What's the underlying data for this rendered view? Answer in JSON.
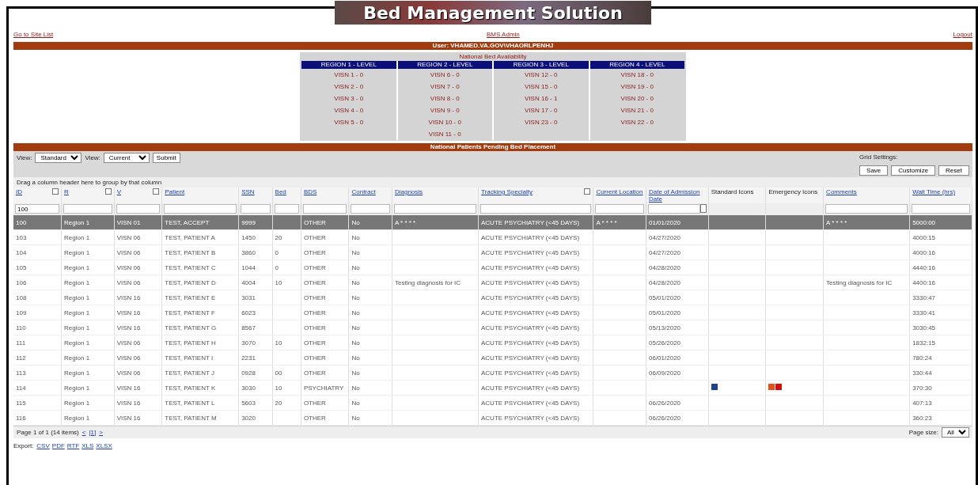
{
  "banner": {
    "title": "Bed Management Solution"
  },
  "top_links": [
    "Go to Site List",
    "BMS Admin",
    "Logout"
  ],
  "user_bar": "User: VHAMED.VA.GOV\\VHAORLPENHJ",
  "availability": {
    "title": "National Bed Availability",
    "regions": [
      {
        "label": "REGION 1 - LEVEL",
        "items": [
          "VISN 1 - 0",
          "VISN 2 - 0",
          "VISN 3 - 0",
          "VISN 4 - 0",
          "VISN 5 - 0"
        ]
      },
      {
        "label": "REGION 2 - LEVEL",
        "items": [
          "VISN 6 - 0",
          "VISN 7 - 0",
          "VISN 8 - 0",
          "VISN 9 - 0",
          "VISN 10 - 0",
          "VISN 11 - 0"
        ]
      },
      {
        "label": "REGION 3 - LEVEL",
        "items": [
          "VISN 12 - 0",
          "VISN 15 - 0",
          "VISN 16 - 1",
          "VISN 17 - 0",
          "VISN 23 - 0"
        ]
      },
      {
        "label": "REGION 4 - LEVEL",
        "items": [
          "VISN 18 - 0",
          "VISN 19 - 0",
          "VISN 20 - 0",
          "VISN 21 - 0",
          "VISN 22 - 0"
        ]
      }
    ]
  },
  "section_title": "National Patients Pending Bed Placement",
  "toolbar": {
    "view_label_1": "View:",
    "view_1": "Standard",
    "view_label_2": "View:",
    "view_2": "Current",
    "submit": "Submit",
    "grid_settings": "Grid Settings:",
    "buttons": [
      "Save",
      "Customize",
      "Reset"
    ]
  },
  "group_hint": "Drag a column header here to group by that column",
  "table": {
    "columns": [
      {
        "label": "ID",
        "kind": "link",
        "filter_menu": true,
        "filter_value": "100"
      },
      {
        "label": "R",
        "kind": "link",
        "filter_menu": true
      },
      {
        "label": "V",
        "kind": "link",
        "filter_menu": true
      },
      {
        "label": "Patient",
        "kind": "link",
        "filter_menu": false
      },
      {
        "label": "SSN",
        "kind": "link",
        "filter_menu": false
      },
      {
        "label": "Bed",
        "kind": "link",
        "filter_menu": false
      },
      {
        "label": "BDS",
        "kind": "link",
        "filter_menu": false
      },
      {
        "label": "Contract",
        "kind": "link",
        "filter_menu": false
      },
      {
        "label": "Diagnosis",
        "kind": "link",
        "filter_menu": false
      },
      {
        "label": "Tracking Specialty",
        "kind": "link",
        "filter_menu": true
      },
      {
        "label": "Current Location",
        "kind": "link",
        "filter_menu": false
      },
      {
        "label": "Date of Admission Date",
        "kind": "date",
        "filter_menu": false
      },
      {
        "label": "Standard Icons",
        "kind": "icons",
        "filter_menu": false
      },
      {
        "label": "Emergency Icons",
        "kind": "icons",
        "filter_menu": false
      },
      {
        "label": "Comments",
        "kind": "link",
        "filter_menu": false
      },
      {
        "label": "Wait Time (hrs)",
        "kind": "link",
        "filter_menu": false
      }
    ],
    "rows": [
      {
        "selected": true,
        "cells": [
          "100",
          "Region 1",
          "VISN 01",
          "TEST, ACCEPT",
          "9999",
          null,
          "OTHER",
          "No",
          "A * * * *",
          "ACUTE PSYCHIATRY (<45 DAYS)",
          "A * * * *",
          "01/01/2020",
          null,
          null,
          "A * * * *",
          "5000:00"
        ]
      },
      {
        "selected": false,
        "cells": [
          "103",
          "Region 1",
          "VISN 06",
          "TEST, PATIENT A",
          "1450",
          "20",
          "OTHER",
          "No",
          null,
          "ACUTE PSYCHIATRY (<45 DAYS)",
          null,
          "04/27/2020",
          null,
          null,
          null,
          "4000:15"
        ]
      },
      {
        "selected": false,
        "cells": [
          "104",
          "Region 1",
          "VISN 06",
          "TEST, PATIENT B",
          "3860",
          "0",
          "OTHER",
          "No",
          null,
          "ACUTE PSYCHIATRY (<45 DAYS)",
          null,
          "04/27/2020",
          null,
          null,
          null,
          "4000:16"
        ]
      },
      {
        "selected": false,
        "cells": [
          "105",
          "Region 1",
          "VISN 06",
          "TEST, PATIENT C",
          "1044",
          "0",
          "OTHER",
          "No",
          null,
          "ACUTE PSYCHIATRY (<45 DAYS)",
          null,
          "04/28/2020",
          null,
          null,
          null,
          "4440:16"
        ]
      },
      {
        "selected": false,
        "cells": [
          "106",
          "Region 1",
          "VISN 06",
          "TEST, PATIENT D",
          "4004",
          "10",
          "OTHER",
          "No",
          "Testing diagnosis for IC",
          "ACUTE PSYCHIATRY (<45 DAYS)",
          null,
          "04/28/2020",
          null,
          null,
          "Testing diagnosis for IC",
          "4400:16"
        ]
      },
      {
        "selected": false,
        "cells": [
          "108",
          "Region 1",
          "VISN 16",
          "TEST, PATIENT E",
          "3031",
          null,
          "OTHER",
          "No",
          null,
          "ACUTE PSYCHIATRY (<45 DAYS)",
          null,
          "05/01/2020",
          null,
          null,
          null,
          "3330:47"
        ]
      },
      {
        "selected": false,
        "cells": [
          "109",
          "Region 1",
          "VISN 16",
          "TEST, PATIENT F",
          "6023",
          null,
          "OTHER",
          "No",
          null,
          "ACUTE PSYCHIATRY (<45 DAYS)",
          null,
          "05/01/2020",
          null,
          null,
          null,
          "3330:41"
        ]
      },
      {
        "selected": false,
        "cells": [
          "110",
          "Region 1",
          "VISN 16",
          "TEST, PATIENT G",
          "8567",
          null,
          "OTHER",
          "No",
          null,
          "ACUTE PSYCHIATRY (<45 DAYS)",
          null,
          "05/13/2020",
          null,
          null,
          null,
          "3030:45"
        ]
      },
      {
        "selected": false,
        "cells": [
          "111",
          "Region 1",
          "VISN 06",
          "TEST, PATIENT H",
          "3070",
          "10",
          "OTHER",
          "No",
          null,
          "ACUTE PSYCHIATRY (<45 DAYS)",
          null,
          "05/26/2020",
          null,
          null,
          null,
          "1832:15"
        ]
      },
      {
        "selected": false,
        "cells": [
          "112",
          "Region 1",
          "VISN 06",
          "TEST, PATIENT I",
          "2231",
          null,
          "OTHER",
          "No",
          null,
          "ACUTE PSYCHIATRY (<45 DAYS)",
          null,
          "06/01/2020",
          null,
          null,
          null,
          "780:24"
        ]
      },
      {
        "selected": false,
        "cells": [
          "113",
          "Region 1",
          "VISN 06",
          "TEST, PATIENT J",
          "0928",
          "00",
          "OTHER",
          "No",
          null,
          "ACUTE PSYCHIATRY (<45 DAYS)",
          null,
          "06/09/2020",
          null,
          null,
          null,
          "330:44"
        ]
      },
      {
        "selected": false,
        "cells": [
          "114",
          "Region 1",
          "VISN 16",
          "TEST, PATIENT K",
          "3030",
          "10",
          "PSYCHIATRY",
          "No",
          null,
          "ACUTE PSYCHIATRY (<45 DAYS)",
          null,
          null,
          null,
          null,
          null,
          "370:30"
        ],
        "standard_icons": [
          {
            "color": "#1f3f8f"
          }
        ],
        "emergency_icons": [
          {
            "color": "#e8501a"
          },
          {
            "color": "#d01010"
          }
        ]
      },
      {
        "selected": false,
        "cells": [
          "115",
          "Region 1",
          "VISN 16",
          "TEST, PATIENT L",
          "5603",
          "20",
          "OTHER",
          "No",
          null,
          "ACUTE PSYCHIATRY (<45 DAYS)",
          null,
          "06/26/2020",
          null,
          null,
          null,
          "407:13"
        ]
      },
      {
        "selected": false,
        "cells": [
          "116",
          "Region 1",
          "VISN 16",
          "TEST, PATIENT M",
          "3020",
          null,
          "OTHER",
          "No",
          null,
          "ACUTE PSYCHIATRY (<45 DAYS)",
          null,
          "06/26/2020",
          null,
          null,
          null,
          "360:23"
        ]
      }
    ]
  },
  "pager": {
    "text": "Page 1 of 1 (14 items)",
    "prev": "<",
    "page": "[1]",
    "next": ">",
    "page_size_label": "Page size:",
    "page_size": "All"
  },
  "export": [
    "Export:",
    "CSV",
    "PDF",
    "RTF",
    "XLS",
    "XLSX"
  ]
}
